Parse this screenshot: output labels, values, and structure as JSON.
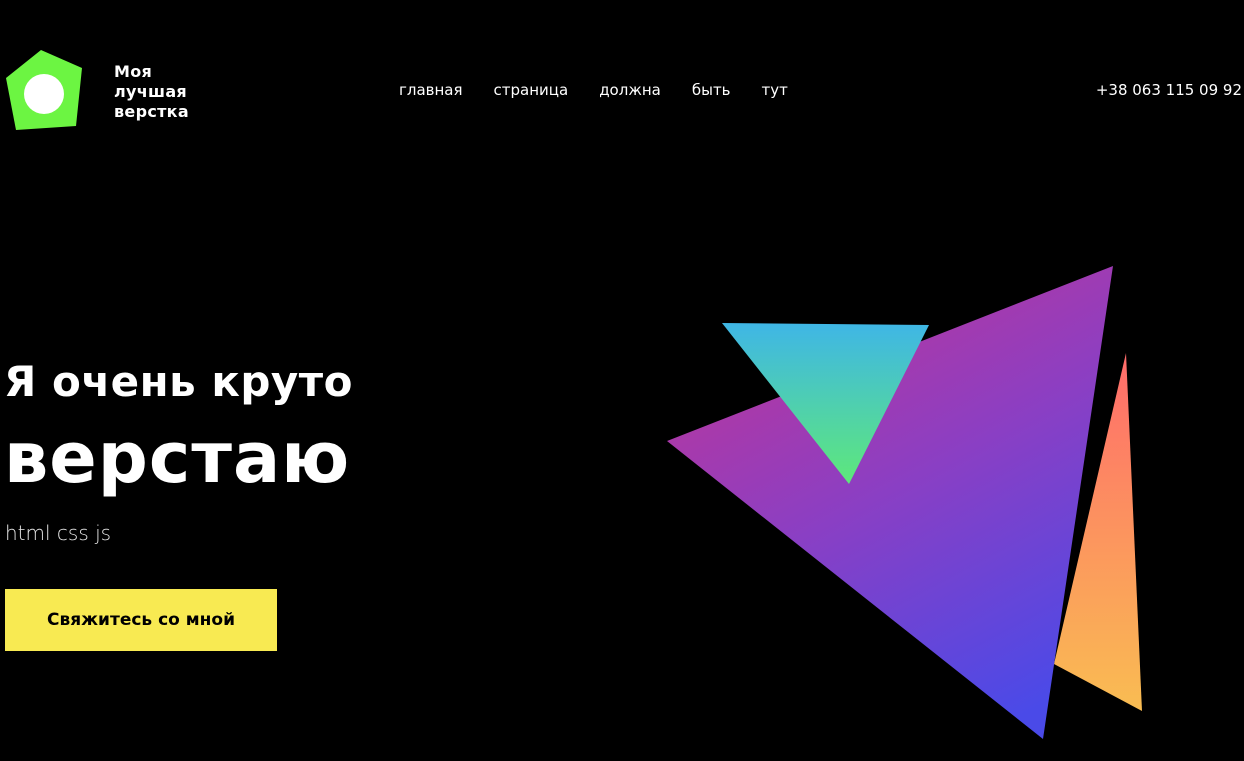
{
  "header": {
    "brand_lines": [
      "Моя",
      "лучшая",
      "верстка"
    ],
    "nav": [
      "главная",
      "страница",
      "должна",
      "быть",
      "тут"
    ],
    "phone": "+38 063 115 09 92"
  },
  "hero": {
    "title_line1": "Я очень круто",
    "title_line2": "верстаю",
    "subtitle": "html css js",
    "cta_label": "Свяжитесь со мной"
  },
  "colors": {
    "background": "#000000",
    "logo_green": "#6cf542",
    "cta_yellow": "#f8ea52",
    "triangle_magenta": "#c13596",
    "triangle_blue": "#4a4ae8",
    "triangle_cyan": "#3fb6e6",
    "triangle_green": "#5ee87a",
    "triangle_coral": "#ff6b6b",
    "triangle_orange": "#f9bd52"
  }
}
